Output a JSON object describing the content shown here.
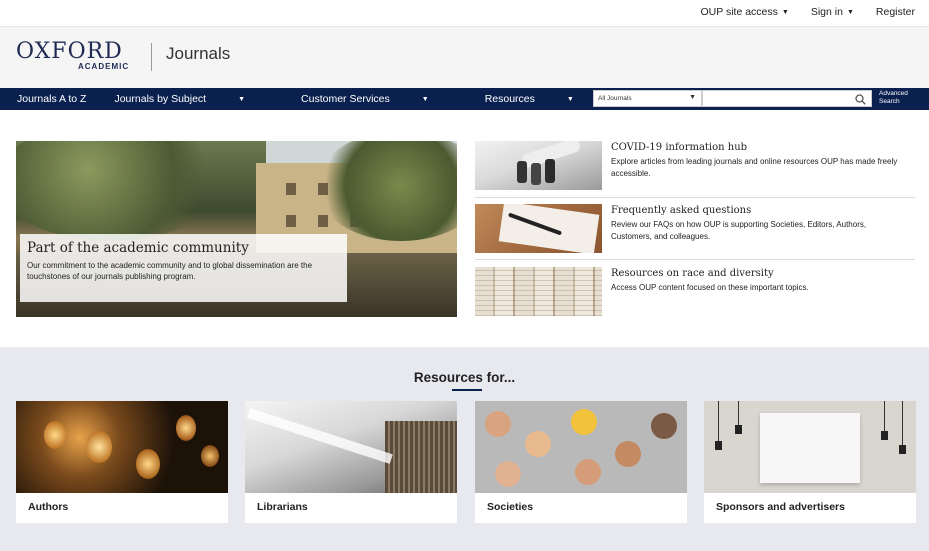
{
  "topbar": {
    "site_access": "OUP site access",
    "sign_in": "Sign in",
    "register": "Register"
  },
  "header": {
    "logo_main": "OXFORD",
    "logo_sub": "ACADEMIC",
    "title": "Journals"
  },
  "nav": {
    "items": [
      "Journals A to Z",
      "Journals by Subject",
      "Customer Services",
      "Resources"
    ],
    "select_value": "All Journals",
    "advanced_line1": "Advanced",
    "advanced_line2": "Search"
  },
  "hero": {
    "title": "Part of the academic community",
    "description": "Our commitment to the academic community and to global dissemination are the touchstones of our journals publishing program."
  },
  "side_items": [
    {
      "title": "COVID-19 information hub",
      "description": "Explore articles from leading journals and online resources OUP has made freely accessible."
    },
    {
      "title": "Frequently asked questions",
      "description": "Review our FAQs on how OUP is supporting Societies, Editors, Authors, Customers, and colleagues."
    },
    {
      "title": "Resources on race and diversity",
      "description": "Access OUP content focused on these important topics."
    }
  ],
  "resources": {
    "title": "Resources for...",
    "cards": [
      "Authors",
      "Librarians",
      "Societies",
      "Sponsors and advertisers"
    ]
  },
  "colors": {
    "navy": "#0a2150",
    "logo_blue": "#1f2b53",
    "resources_bg": "#e8e9ee"
  }
}
